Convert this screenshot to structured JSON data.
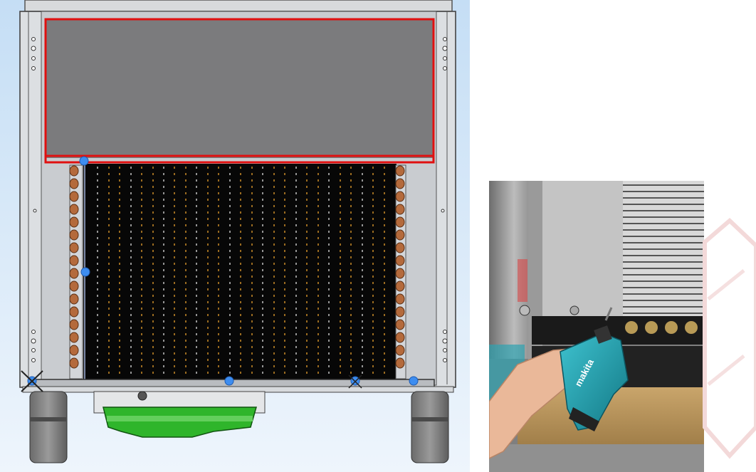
{
  "scene": {
    "left_panel": {
      "subject": "cad-drawing",
      "highlight_color": "#e01010",
      "pin_color": "#3d8df0",
      "drip_tray_color": "#2fb52b",
      "coil_fin_color": "#d9962a"
    },
    "right_panel": {
      "subject": "photo-drill-on-condenser",
      "drill_brand": "makita",
      "drill_color": "#1fa3b3"
    }
  }
}
